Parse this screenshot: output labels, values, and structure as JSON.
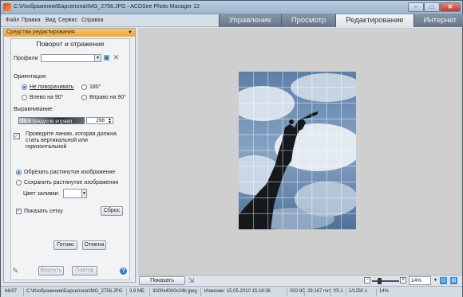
{
  "window": {
    "title": "C:\\Изображения\\Барселона\\IMG_2756.JPG - ACDSee Photo Manager 12",
    "minimize_glyph": "–",
    "maximize_glyph": "□",
    "close_glyph": "✕"
  },
  "menu": {
    "items": [
      "Файл",
      "Правка",
      "Вид",
      "Сервис",
      "Справка"
    ]
  },
  "mode_tabs": [
    {
      "label": "Управление",
      "active": false
    },
    {
      "label": "Просмотр",
      "active": false
    },
    {
      "label": "Редактирование",
      "active": true
    },
    {
      "label": "Интернет",
      "active": false
    }
  ],
  "side_pane": {
    "header": "Средства редактирования",
    "panel_title": "Поворот и отражение",
    "profiles_label": "Профили",
    "profiles_value": "",
    "orientation_label": "Ориентация:",
    "orientation_options": [
      {
        "label": "Не поворачивать",
        "selected": true
      },
      {
        "label": "180°",
        "selected": false
      },
      {
        "label": "Влево на 90°",
        "selected": false
      },
      {
        "label": "Вправо на 90°",
        "selected": false
      }
    ],
    "alignment_label": "Выравнивание:",
    "slider_text": "29.8 градусов вправо",
    "slider_value": "298",
    "hint_text": [
      "Проведите линию, которая должна",
      "стать вертикальной или",
      "горизонтальной"
    ],
    "crop_options": [
      {
        "label": "Обрезать растянутое изображение",
        "selected": true
      },
      {
        "label": "Сохранить растянутое изображения",
        "selected": false
      }
    ],
    "fill_color_label": "Цвет заливки:",
    "fill_color": "#ffffff",
    "show_grid_label": "Показать сетку",
    "show_grid_checked": true,
    "reset_button": "Сброс",
    "done_button": "Готово",
    "cancel_button": "Отмена",
    "undo_button": "Вернуть",
    "redo_button": "Повтор"
  },
  "bottom_bar": {
    "show_original_button": "Показать прежнее",
    "zoom_value": "14%"
  },
  "status_bar": {
    "index": "66/97",
    "path": "C:\\Изображения\\Барселона\\IMG_2756.JPG",
    "size": "3,9 МБ",
    "dimensions": "3000x4000x24b jpeg",
    "modified": "Изменен: 15.05.2010 15:18:36",
    "iso": "ISO 80",
    "focal": "29.167 mm",
    "aperture": "f/5.1",
    "shutter": "1/1250 s",
    "zoom": "14%"
  },
  "colors": {
    "accent_header": "#f0a431",
    "active_tab": "#eef1f4",
    "inactive_tab": "#76869a"
  }
}
